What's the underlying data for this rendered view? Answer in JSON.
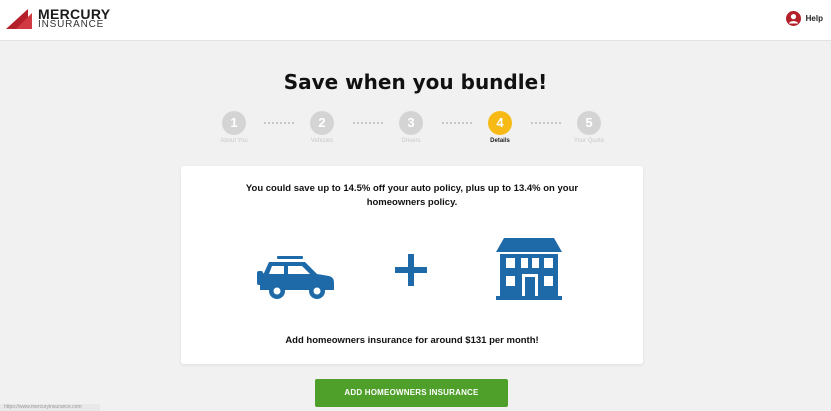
{
  "header": {
    "brand": "MERCURY",
    "brand_sub": "INSURANCE",
    "help_label": "Help"
  },
  "page": {
    "title": "Save when you bundle!"
  },
  "stepper": {
    "active_step": 4,
    "steps": [
      {
        "number": "1",
        "label": "About You"
      },
      {
        "number": "2",
        "label": "Vehicles"
      },
      {
        "number": "3",
        "label": "Drivers"
      },
      {
        "number": "4",
        "label": "Details"
      },
      {
        "number": "5",
        "label": "Your Quote"
      }
    ]
  },
  "bundle_card": {
    "message": "You could save up to 14.5% off your auto policy, plus up to 13.4% on your homeowners policy.",
    "bottom_message": "Add homeowners insurance for around $131 per month!"
  },
  "cta": {
    "label": "ADD HOMEOWNERS INSURANCE"
  },
  "statusbar": {
    "text": "https://www.mercuryinsurance.com"
  },
  "colors": {
    "brand_red": "#b3202a",
    "active_step": "#f6b915",
    "icon_blue": "#1e6aa8",
    "cta_green": "#4fa02b",
    "inactive_step": "#d4d4d4"
  },
  "icons": [
    "mercury-logo-icon",
    "help-user-icon",
    "car-icon",
    "plus-icon",
    "house-icon"
  ]
}
